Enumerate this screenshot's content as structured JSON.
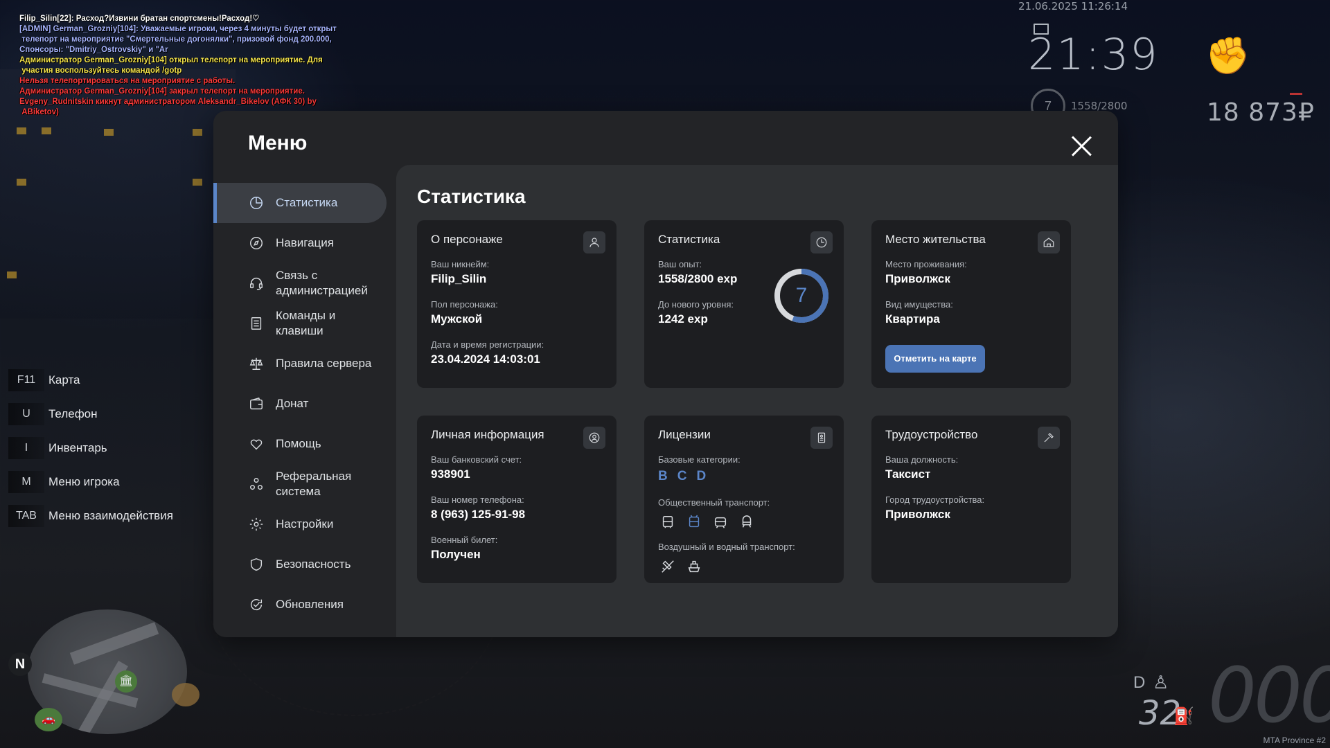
{
  "chat": [
    {
      "text": "Filip_Silin[22]: Расход?Извини братан спортсмены!Расход!♡",
      "color": "#ffffff"
    },
    {
      "text": "[ADMIN] German_Grozniy[104]: Уважаемые игроки, через 4 минуты будет открыт\n телепорт на мероприятие \"Смертельные догонялки\", призовой фонд 200.000,\nСпонсоры: \"Dmitriy_Ostrovskiy\" и \"Ar",
      "color": "#a6b4ff"
    },
    {
      "text": "Администратор German_Grozniy[104] открыл телепорт на мероприятие. Для\n участия воспользуйтесь командой /gotp",
      "color": "#f2e24a"
    },
    {
      "text": "Нельзя телепортироваться на мероприятие с работы.",
      "color": "#ff3b3b"
    },
    {
      "text": "Администратор German_Grozniy[104] закрыл телепорт на мероприятие.",
      "color": "#ff3b3b"
    },
    {
      "text": "Evgeny_Rudnitskin кикнут администратором Aleksandr_Bikelov (АФК 30) by\n ABiketov)",
      "color": "#ff3b3b"
    }
  ],
  "hud": {
    "datetime": "21.06.2025 11:26:14",
    "time": "21:39",
    "level": "7",
    "xp": "1558/2800",
    "money": "18 873₽",
    "gear": "D",
    "fuel": "32",
    "speed": "000",
    "server": "MTA Province #2"
  },
  "keybinds": [
    {
      "key": "F11",
      "label": "Карта"
    },
    {
      "key": "U",
      "label": "Телефон"
    },
    {
      "key": "I",
      "label": "Инвентарь"
    },
    {
      "key": "M",
      "label": "Меню игрока"
    },
    {
      "key": "TAB",
      "label": "Меню взаимодействия"
    }
  ],
  "minimap": {
    "north": "N"
  },
  "menu": {
    "title": "Меню",
    "nav": [
      {
        "label": "Статистика",
        "icon": "pie-chart-icon"
      },
      {
        "label": "Навигация",
        "icon": "compass-icon"
      },
      {
        "label": "Связь с\nадминистрацией",
        "icon": "headset-icon"
      },
      {
        "label": "Команды и\nклавиши",
        "icon": "document-icon"
      },
      {
        "label": "Правила сервера",
        "icon": "scales-icon"
      },
      {
        "label": "Донат",
        "icon": "wallet-icon"
      },
      {
        "label": "Помощь",
        "icon": "hand-heart-icon"
      },
      {
        "label": "Реферальная\nсистема",
        "icon": "people-icon"
      },
      {
        "label": "Настройки",
        "icon": "gear-icon"
      },
      {
        "label": "Безопасность",
        "icon": "shield-icon"
      },
      {
        "label": "Обновления",
        "icon": "refresh-check-icon"
      }
    ],
    "active": "Статистика"
  },
  "stats": {
    "title": "Статистика",
    "character": {
      "title": "О персонаже",
      "nickname_label": "Ваш никнейм:",
      "nickname": "Filip_Silin",
      "gender_label": "Пол персонажа:",
      "gender": "Мужской",
      "reg_label": "Дата и время регистрации:",
      "reg": "23.04.2024 14:03:01"
    },
    "statistics": {
      "title": "Статистика",
      "exp_label": "Ваш опыт:",
      "exp": "1558/2800 exp",
      "next_label": "До нового уровня:",
      "next": "1242 exp",
      "level": "7",
      "progress": 0.556
    },
    "residence": {
      "title": "Место жительства",
      "place_label": "Место проживания:",
      "place": "Приволжск",
      "property_label": "Вид имущества:",
      "property": "Квартира",
      "button": "Отметить на карте"
    },
    "personal": {
      "title": "Личная информация",
      "bank_label": "Ваш банковский счет:",
      "bank": "938901",
      "phone_label": "Ваш номер телефона:",
      "phone": "8 (963) 125-91-98",
      "military_label": "Военный билет:",
      "military": "Получен"
    },
    "licenses": {
      "title": "Лицензии",
      "base_label": "Базовые категории:",
      "base": [
        "B",
        "C",
        "D"
      ],
      "public_label": "Общественный транспорт:",
      "air_label": "Воздушный и водный транспорт:"
    },
    "job": {
      "title": "Трудоустройство",
      "position_label": "Ваша должность:",
      "position": "Таксист",
      "city_label": "Город трудоустройства:",
      "city": "Приволжск"
    }
  }
}
